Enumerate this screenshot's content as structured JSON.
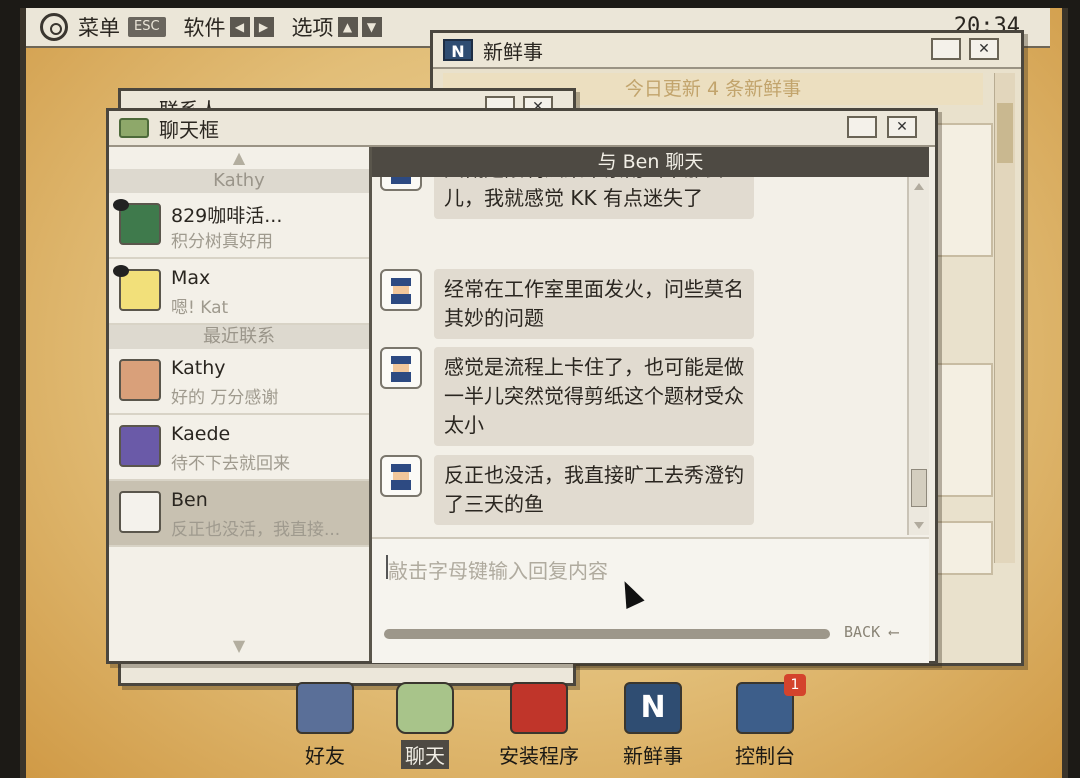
{
  "menubar": {
    "menu_label": "菜单",
    "menu_key": "ESC",
    "software_label": "软件",
    "options_label": "选项",
    "clock": "20:34"
  },
  "news_window": {
    "title": "新鲜事",
    "banner": "今日更新 4 条新鲜事",
    "icon": "N"
  },
  "contacts_window": {
    "title": "联系人"
  },
  "chat_window": {
    "title": "聊天框",
    "header": "与 Ben 聊天",
    "input_placeholder": "敲击字母键输入回复内容",
    "back_label": "BACK",
    "contacts": {
      "top_section": "Kathy",
      "recent_section": "最近联系",
      "items": [
        {
          "name": "829咖啡活...",
          "preview": "积分树真好用"
        },
        {
          "name": "Max",
          "preview": "嗯! Kat"
        },
        {
          "name": "Kathy",
          "preview": "好的 万分感谢"
        },
        {
          "name": "Kaede",
          "preview": "待不下去就回来"
        },
        {
          "name": "Ben",
          "preview": "反正也没活，我直接..."
        }
      ]
    },
    "messages": [
      {
        "text": "大概是限制法棠草素南出来那会儿，我就感觉 KK 有点迷失了"
      },
      {
        "text": "经常在工作室里面发火，问些莫名其妙的问题"
      },
      {
        "text": "感觉是流程上卡住了，也可能是做一半儿突然觉得剪纸这个题材受众太小"
      },
      {
        "text": "反正也没活，我直接旷工去秀澄钓了三天的鱼"
      }
    ]
  },
  "dock": {
    "items": [
      {
        "label": "好友",
        "icon": "contacts-book-icon"
      },
      {
        "label": "聊天",
        "icon": "chat-bubble-icon"
      },
      {
        "label": "安装程序",
        "icon": "install-icon"
      },
      {
        "label": "新鲜事",
        "icon": "news-icon"
      },
      {
        "label": "控制台",
        "icon": "control-panel-icon",
        "badge": "1"
      }
    ]
  }
}
